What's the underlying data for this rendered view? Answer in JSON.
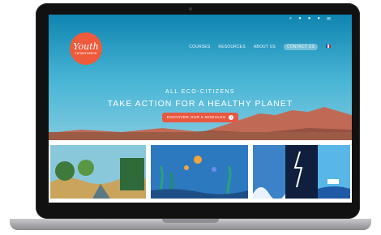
{
  "site": {
    "logo_line1": "Youth",
    "logo_line2": "conservation"
  },
  "nav": {
    "items": [
      "COURSES",
      "RESOURCES",
      "ABOUT US",
      "CONTACT US"
    ]
  },
  "topbar": {
    "icons": [
      "search-icon",
      "facebook-icon",
      "instagram-icon",
      "linkedin-icon",
      "email-icon"
    ]
  },
  "hero": {
    "kicker": "ALL ECO-CITIZENS",
    "headline": "TAKE ACTION FOR A HEALTHY PLANET",
    "cta_label": "DISCOVER OUR 6 MODULES"
  }
}
